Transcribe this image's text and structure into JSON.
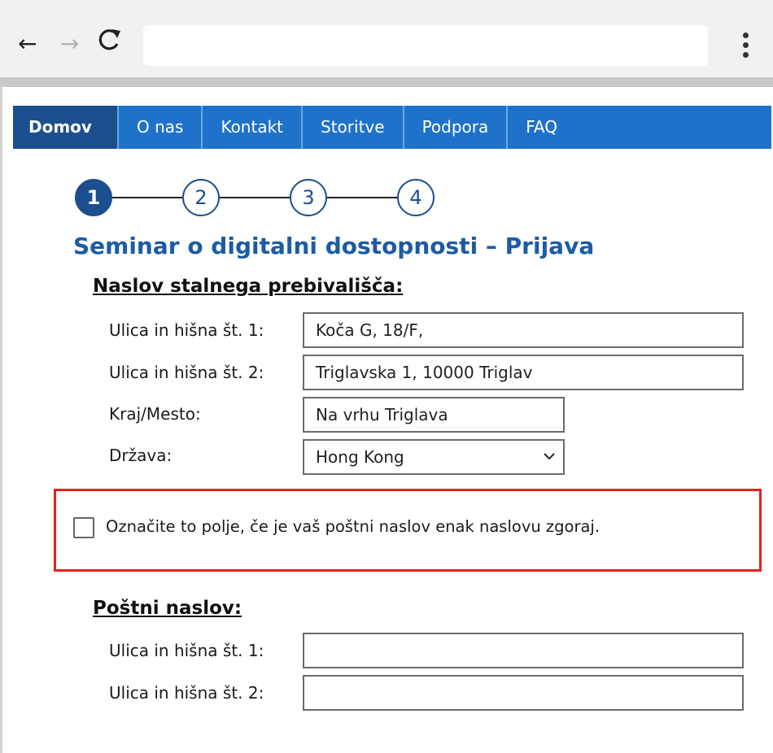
{
  "browser": {
    "back_icon": "←",
    "forward_icon": "→",
    "reload_icon": "C",
    "address_value": ""
  },
  "sitenav": {
    "tabs": [
      {
        "label": "Domov",
        "active": true
      },
      {
        "label": "O nas",
        "active": false
      },
      {
        "label": "Kontakt",
        "active": false
      },
      {
        "label": "Storitve",
        "active": false
      },
      {
        "label": "Podpora",
        "active": false
      },
      {
        "label": "FAQ",
        "active": false
      }
    ]
  },
  "stepper": {
    "steps": [
      "1",
      "2",
      "3",
      "4"
    ],
    "current": 1
  },
  "page": {
    "title": "Seminar o digitalni dostopnosti – Prijava"
  },
  "permanent_address": {
    "heading": "Naslov stalnega prebivališča:",
    "street1_label": "Ulica in hišna št. 1:",
    "street1_value": "Koča G, 18/F,",
    "street2_label": "Ulica in hišna št. 2:",
    "street2_value": "Triglavska 1, 10000 Triglav",
    "city_label": "Kraj/Mesto:",
    "city_value": "Na vrhu Triglava",
    "country_label": "Država:",
    "country_value": "Hong Kong"
  },
  "same_address": {
    "label": "Označite to polje, če je vaš poštni naslov enak naslovu zgoraj.",
    "checked": false,
    "highlight_color": "#e0241c"
  },
  "postal_address": {
    "heading": "Poštni naslov:",
    "street1_label": "Ulica in hišna št. 1:",
    "street1_value": "",
    "street2_label": "Ulica in hišna št. 2:",
    "street2_value": ""
  },
  "colors": {
    "nav_bg": "#1f72c9",
    "nav_active": "#1c4f8d",
    "title": "#1c5ba6"
  }
}
